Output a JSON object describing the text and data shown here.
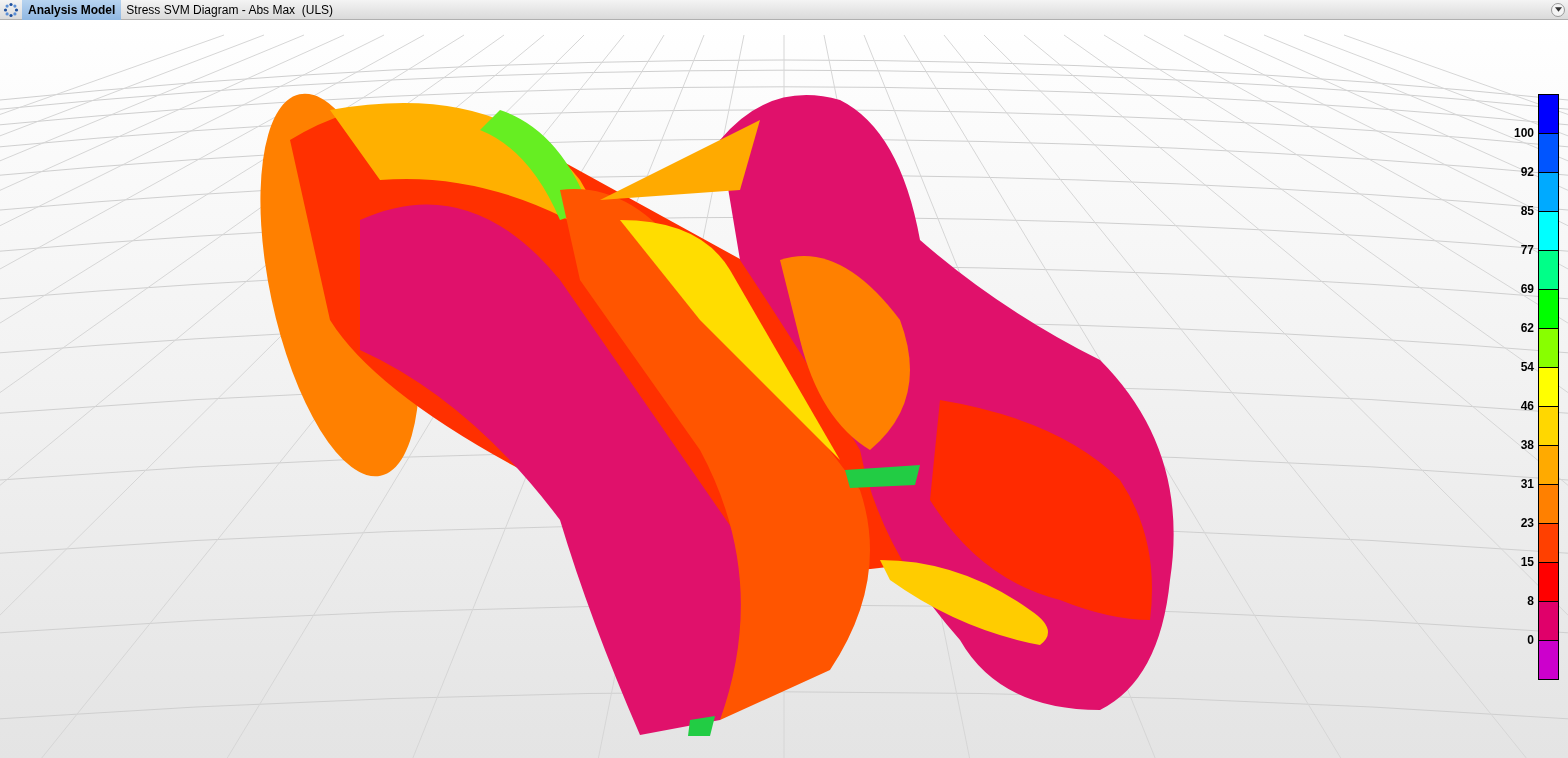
{
  "header": {
    "tabs": [
      {
        "label": "Analysis Model",
        "selected": true
      }
    ],
    "title": "Stress SVM Diagram - Abs Max  (ULS)"
  },
  "legend": {
    "bands": [
      {
        "color": "#0000ff",
        "label": "100"
      },
      {
        "color": "#0055ff",
        "label": "92"
      },
      {
        "color": "#00aaff",
        "label": "85"
      },
      {
        "color": "#00ffff",
        "label": "77"
      },
      {
        "color": "#00ff88",
        "label": "69"
      },
      {
        "color": "#00ff00",
        "label": "62"
      },
      {
        "color": "#88ff00",
        "label": "54"
      },
      {
        "color": "#ffff00",
        "label": "46"
      },
      {
        "color": "#ffd700",
        "label": "38"
      },
      {
        "color": "#ffaa00",
        "label": "31"
      },
      {
        "color": "#ff8000",
        "label": "23"
      },
      {
        "color": "#ff4000",
        "label": "15"
      },
      {
        "color": "#ff0000",
        "label": "8"
      },
      {
        "color": "#e0006a",
        "label": "0"
      },
      {
        "color": "#cc00cc"
      }
    ]
  }
}
